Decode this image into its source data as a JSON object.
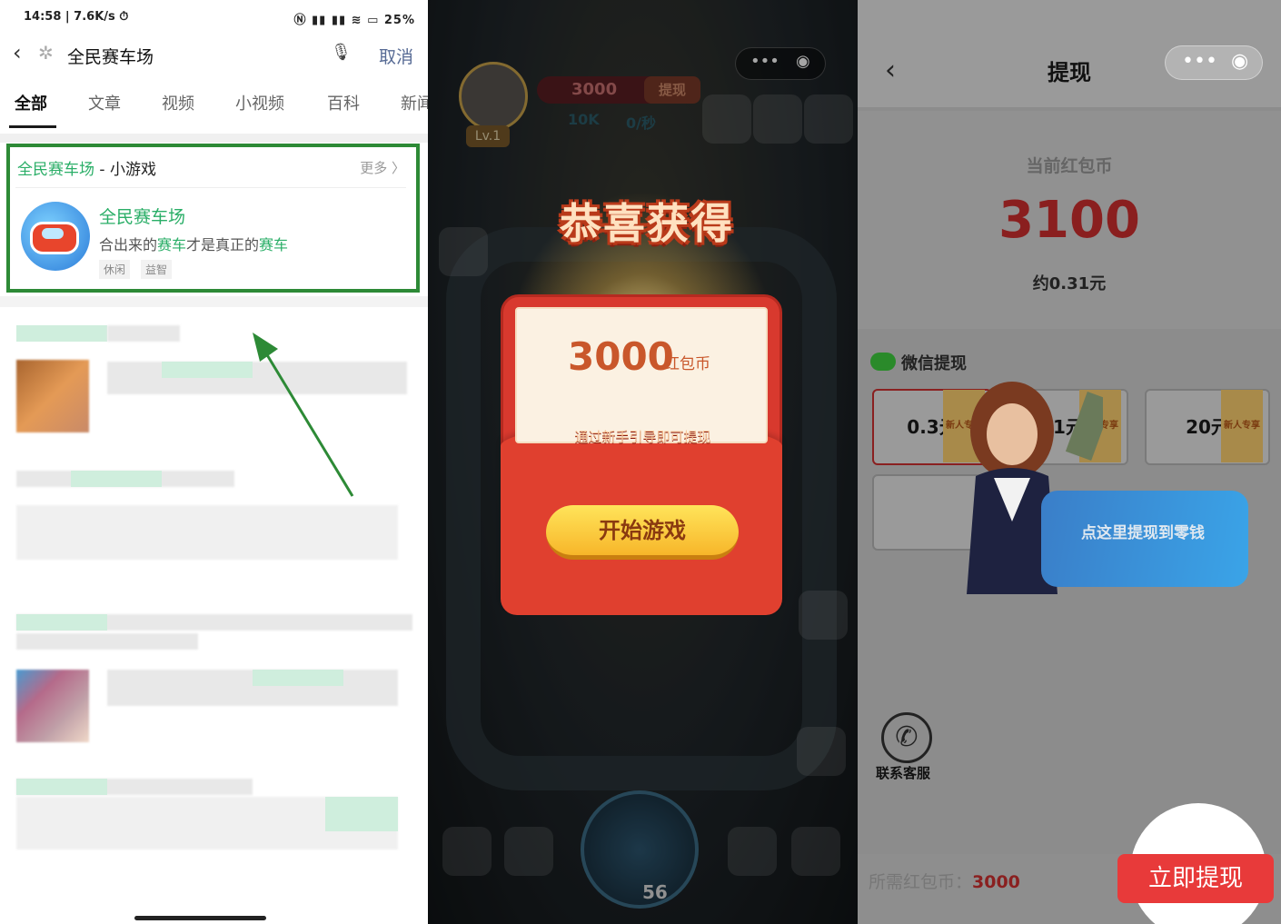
{
  "left": {
    "status": {
      "time": "14:58 | 7.6K/s ⏱",
      "right": "Ⓝ ▮▮ ▮▮ ≋ ▭ 25%"
    },
    "search": {
      "query": "全民赛车场",
      "cancel": "取消"
    },
    "tabs": [
      "全部",
      "文章",
      "视频",
      "小视频",
      "百科",
      "新闻"
    ],
    "result": {
      "header_green": "全民赛车场",
      "header_rest": " - 小游戏",
      "more": "更多 〉",
      "name": "全民赛车场",
      "desc_parts": [
        "合出来的",
        "赛车",
        "才是真正的",
        "赛车"
      ],
      "tags": [
        "休闲",
        "益智"
      ]
    },
    "colors": {
      "highlight": "#2d8a36",
      "link_green": "#2aae67"
    }
  },
  "middle": {
    "level": "Lv.1",
    "coins": "3000",
    "coin_button": "提现",
    "speed": "10K",
    "rate": "0/秒",
    "title": "恭喜获得",
    "amount": "3000",
    "unit": "红包币",
    "hint": "通过新手引导即可提现",
    "start": "开始游戏",
    "bottom_num": "56"
  },
  "right": {
    "title": "提现",
    "balance_label": "当前红包币",
    "balance": "3100",
    "balance_yuan": "约0.31元",
    "wechat_label": "微信提现",
    "options": [
      "0.3元",
      "1元",
      "20元"
    ],
    "option_badge": "新人专享",
    "callout": "点这里提现到零钱",
    "contact": "联系客服",
    "needed_label": "所需红包币：",
    "needed_value": "3000",
    "withdraw": "立即提现",
    "colors": {
      "withdraw": "#e83a3a",
      "balance": "#8a1f1f"
    }
  }
}
